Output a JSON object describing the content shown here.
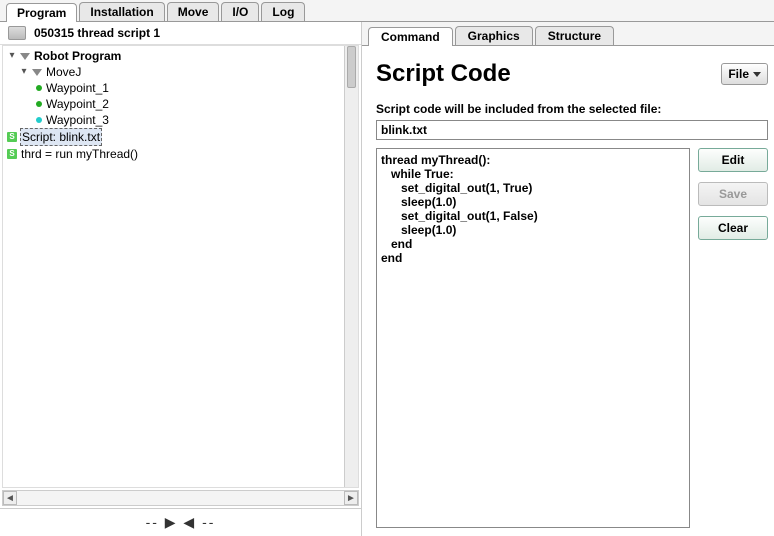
{
  "topTabs": {
    "program": "Program",
    "installation": "Installation",
    "move": "Move",
    "io": "I/O",
    "log": "Log"
  },
  "fileRow": {
    "name": "050315 thread script 1"
  },
  "tree": {
    "root": "Robot Program",
    "movej": "MoveJ",
    "wp1": "Waypoint_1",
    "wp2": "Waypoint_2",
    "wp3": "Waypoint_3",
    "script": "Script: blink.txt",
    "thrd": "thrd = run myThread()"
  },
  "playback": "-- ▶ ◀ --",
  "subTabs": {
    "command": "Command",
    "graphics": "Graphics",
    "structure": "Structure"
  },
  "panel": {
    "title": "Script Code",
    "fileBtn": "File",
    "subtitle": "Script code will be included from the selected file:",
    "fileName": "blink.txt",
    "code": "thread myThread():\n   while True:\n      set_digital_out(1, True)\n      sleep(1.0)\n      set_digital_out(1, False)\n      sleep(1.0)\n   end\nend",
    "edit": "Edit",
    "save": "Save",
    "clear": "Clear"
  }
}
